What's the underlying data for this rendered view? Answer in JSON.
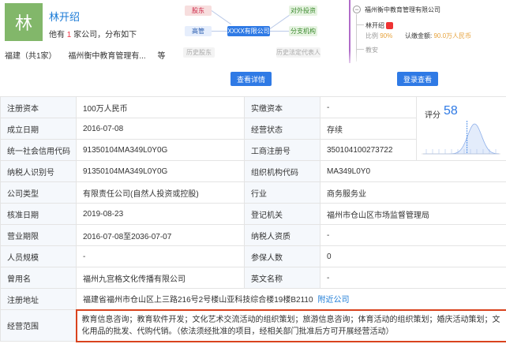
{
  "person": {
    "avatar_char": "林",
    "name": "林开绍",
    "summary_prefix": "他有",
    "summary_count": "1",
    "summary_suffix": "家公司，分布如下",
    "region": "福建（共1家）",
    "company": "福州衡中教育管理有...",
    "etc": "等"
  },
  "graph": {
    "service": "股东",
    "exec": "高管",
    "hist_left": "历史股东",
    "center": "XXXX有限公司",
    "investment": "对外投资",
    "branch": "分支机构",
    "hist_right": "历史法定代表人",
    "button": "查看详情"
  },
  "shareholder": {
    "collapse_symbol": "−",
    "company": "福州衡中教育管理有限公司",
    "person": "林开绍",
    "ratio_label": "比例",
    "ratio_value": "90%",
    "amount_label": "认缴金额:",
    "amount_value": "90.0万人民币",
    "next": "教安",
    "button": "登录查看"
  },
  "score": {
    "label": "评分",
    "value": "58"
  },
  "table": {
    "rows": [
      [
        "注册资本",
        "100万人民币",
        "实缴资本",
        "-"
      ],
      [
        "成立日期",
        "2016-07-08",
        "经营状态",
        "存续"
      ],
      [
        "统一社会信用代码",
        "91350104MA349L0Y0G",
        "工商注册号",
        "350104100273722"
      ],
      [
        "纳税人识别号",
        "91350104MA349L0Y0G",
        "组织机构代码",
        "MA349L0Y0"
      ],
      [
        "公司类型",
        "有限责任公司(自然人投资或控股)",
        "行业",
        "商务服务业"
      ],
      [
        "核准日期",
        "2019-08-23",
        "登记机关",
        "福州市仓山区市场监督管理局"
      ],
      [
        "营业期限",
        "2016-07-08至2036-07-07",
        "纳税人资质",
        "-"
      ],
      [
        "人员规模",
        "-",
        "参保人数",
        "0"
      ],
      [
        "曾用名",
        "福州九宫格文化传播有限公司",
        "英文名称",
        "-"
      ]
    ],
    "address_label": "注册地址",
    "address_value": "福建省福州市仓山区上三路216号2号楼山亚科技综合楼19楼B2110",
    "address_link": "附近公司",
    "scope_label": "经营范围",
    "scope_value": "教育信息咨询；教育软件开发；文化艺术交流活动的组织策划；旅游信息咨询；体育活动的组织策划；婚庆活动策划；文化用品的批发、代购代销。（依法须经批准的项目，经相关部门批准后方可开展经营活动）"
  },
  "colors": {
    "accent": "#2f7ae5",
    "avatar": "#82b76a",
    "highlight_border": "#d9431e"
  }
}
